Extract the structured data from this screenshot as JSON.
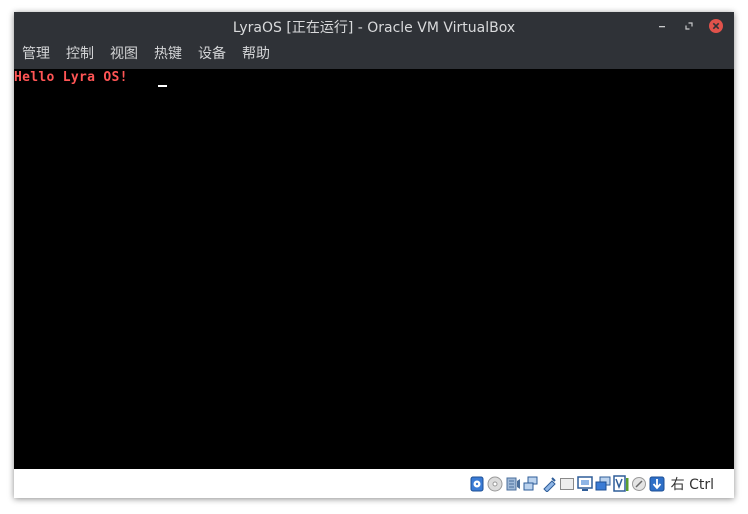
{
  "window": {
    "title": "LyraOS [正在运行] - Oracle VM VirtualBox"
  },
  "menu": {
    "items": [
      "管理",
      "控制",
      "视图",
      "热键",
      "设备",
      "帮助"
    ]
  },
  "screen": {
    "console_text": "Hello Lyra OS!",
    "text_color": "#ff5555",
    "background": "#000000"
  },
  "status": {
    "icons": [
      "hard-disk-icon",
      "optical-drive-icon",
      "audio-icon",
      "network-icon",
      "usb-icon",
      "shared-folders-icon",
      "display-icon",
      "video-capture-icon",
      "cpu-activity-icon",
      "mouse-integration-icon",
      "host-key-arrow-icon"
    ],
    "host_key_label": "右 Ctrl"
  },
  "colors": {
    "titlebar": "#2f3237",
    "close_button": "#e0524b"
  }
}
